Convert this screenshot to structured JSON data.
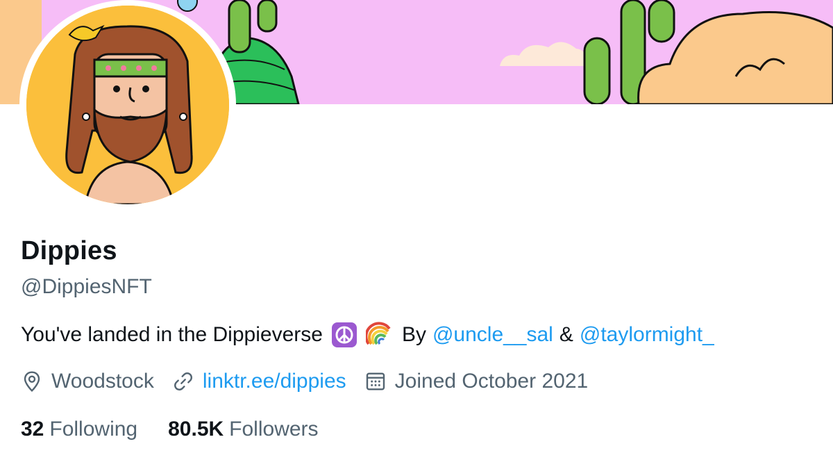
{
  "profile": {
    "display_name": "Dippies",
    "handle": "@DippiesNFT",
    "bio": {
      "text_before": "You've landed in the Dippieverse",
      "peace_emoji": "☮️",
      "rainbow_emoji": "🌈",
      "by_label": "By",
      "mention_1": "@uncle__sal",
      "amp": "&",
      "mention_2": "@taylormight_"
    },
    "location": "Woodstock",
    "website": "linktr.ee/dippies",
    "joined": "Joined October 2021",
    "following_count": "32",
    "following_label": "Following",
    "followers_count": "80.5K",
    "followers_label": "Followers"
  },
  "icons": {
    "location": "location-pin-icon",
    "link": "link-icon",
    "calendar": "calendar-icon"
  },
  "colors": {
    "link": "#1d9bf0",
    "secondary_text": "#536471",
    "primary_text": "#0f1419",
    "banner_pink": "#f6bdf7",
    "banner_orange": "#fbc98c",
    "avatar_bg": "#fbbf3c"
  }
}
